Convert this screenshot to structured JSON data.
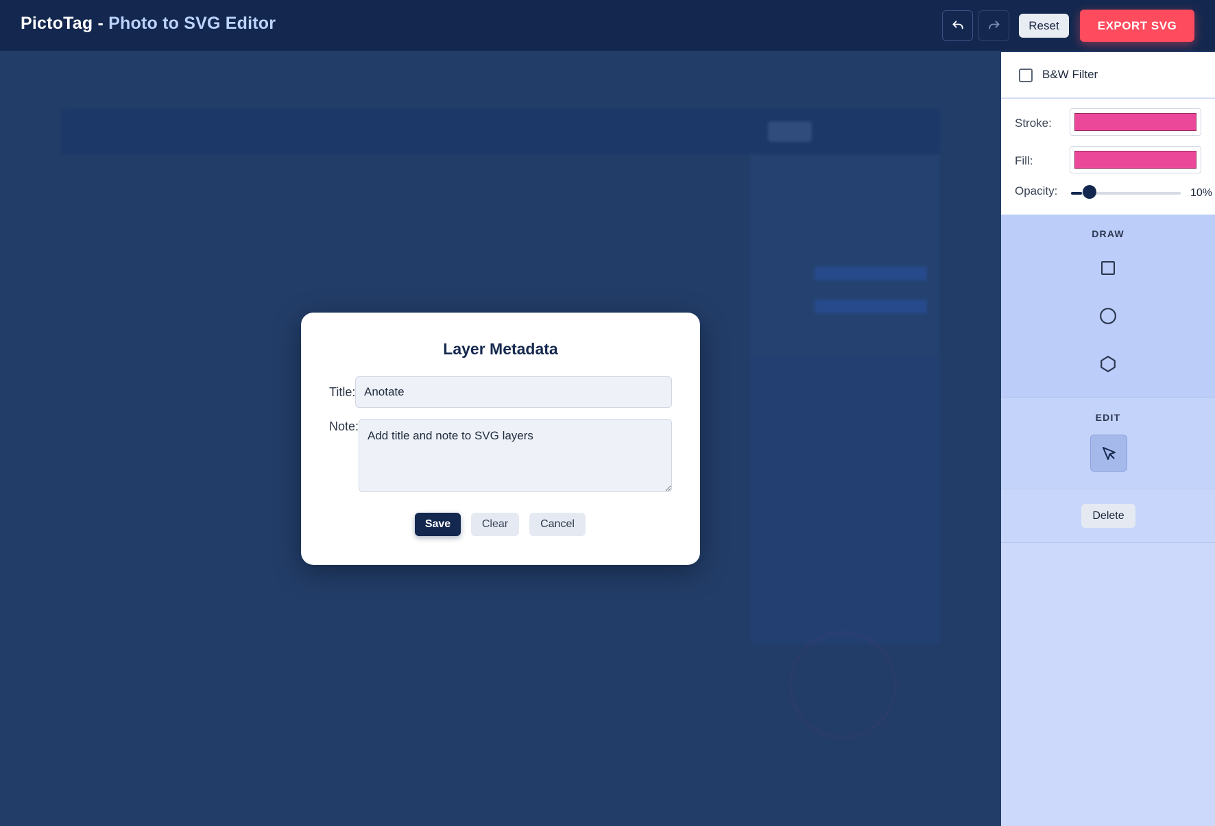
{
  "header": {
    "title_main": "PictoTag - ",
    "title_accent": "Photo to SVG Editor",
    "reset_label": "Reset",
    "export_label": "EXPORT SVG",
    "undo_icon": "undo-icon",
    "redo_icon": "redo-icon"
  },
  "sidebar": {
    "filter_label": "B&W Filter",
    "filter_checked": false,
    "stroke_label": "Stroke:",
    "fill_label": "Fill:",
    "opacity_label": "Opacity:",
    "opacity_value": "10%",
    "opacity_fraction": 0.1,
    "stroke_color": "#ec4899",
    "fill_color": "#ec4899",
    "draw_heading": "DRAW",
    "draw_tools": [
      "rectangle-icon",
      "circle-icon",
      "polygon-icon"
    ],
    "edit_heading": "EDIT",
    "edit_tools": [
      "select-pointer-icon"
    ],
    "delete_label": "Delete"
  },
  "modal": {
    "title": "Layer Metadata",
    "title_label": "Title:",
    "title_value": "Anotate",
    "note_label": "Note:",
    "note_value": "Add title and note to SVG layers",
    "save_label": "Save",
    "clear_label": "Clear",
    "cancel_label": "Cancel"
  },
  "colors": {
    "header_bg": "#14284f",
    "accent_export": "#ff4b5e",
    "swatch": "#ec4899"
  }
}
